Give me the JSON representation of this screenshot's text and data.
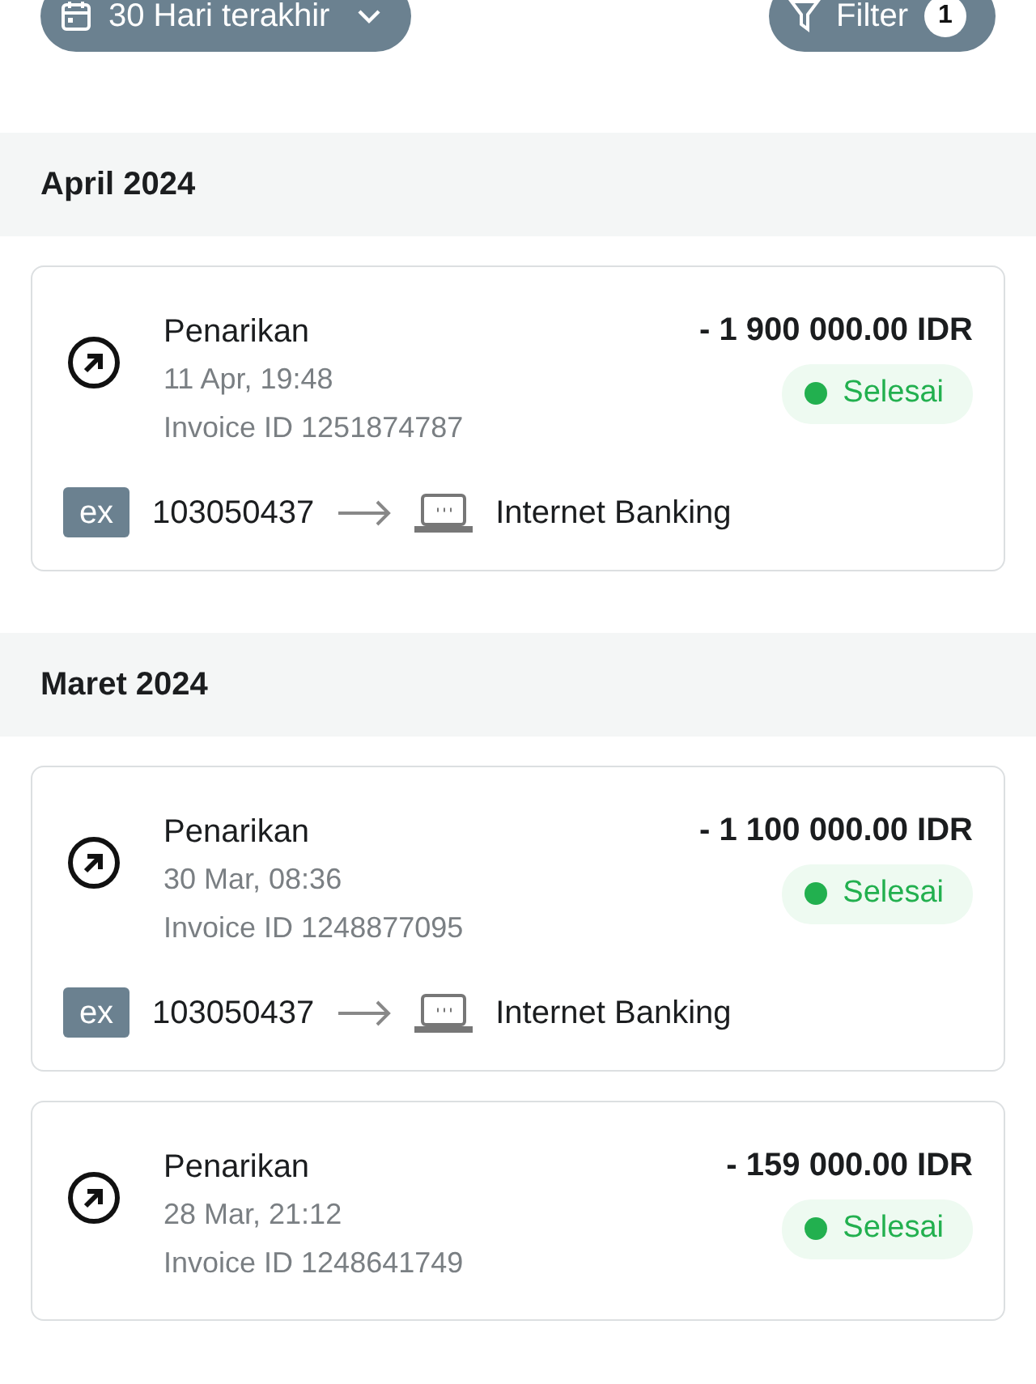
{
  "toolbar": {
    "period_button": "30 Hari terakhir",
    "filter_button": {
      "label": "Filter",
      "count": "1"
    }
  },
  "sections": [
    {
      "month": "April 2024",
      "transactions": [
        {
          "title": "Penarikan",
          "datetime": "11 Apr, 19:48",
          "invoice": "Invoice ID 1251874787",
          "amount": "- 1 900 000.00 IDR",
          "status": "Selesai",
          "route": {
            "logo": "ex",
            "account": "103050437",
            "method": "Internet Banking"
          }
        }
      ]
    },
    {
      "month": "Maret 2024",
      "transactions": [
        {
          "title": "Penarikan",
          "datetime": "30 Mar, 08:36",
          "invoice": "Invoice ID 1248877095",
          "amount": "- 1 100 000.00 IDR",
          "status": "Selesai",
          "route": {
            "logo": "ex",
            "account": "103050437",
            "method": "Internet Banking"
          }
        },
        {
          "title": "Penarikan",
          "datetime": "28 Mar, 21:12",
          "invoice": "Invoice ID 1248641749",
          "amount": "- 159 000.00 IDR",
          "status": "Selesai"
        }
      ]
    }
  ]
}
